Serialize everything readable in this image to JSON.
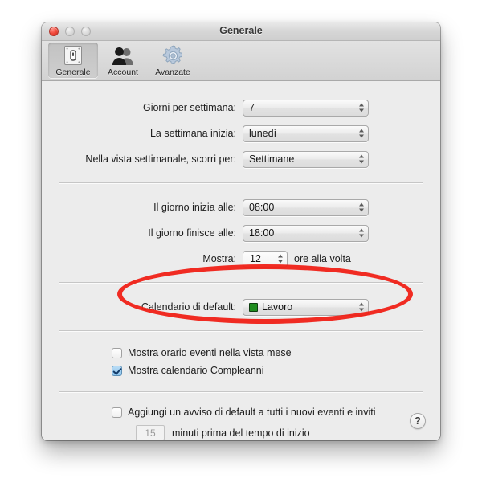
{
  "window": {
    "title": "Generale",
    "controls": {
      "close": "close-button",
      "minimize": "minimize-button",
      "zoom": "zoom-button"
    }
  },
  "toolbar": {
    "items": [
      {
        "label": "Generale",
        "icon": "general-icon",
        "selected": true
      },
      {
        "label": "Account",
        "icon": "accounts-icon",
        "selected": false
      },
      {
        "label": "Avanzate",
        "icon": "gear-icon",
        "selected": false
      }
    ]
  },
  "settings": {
    "group1": [
      {
        "label": "Giorni per settimana:",
        "value": "7"
      },
      {
        "label": "La settimana inizia:",
        "value": "lunedì"
      },
      {
        "label": "Nella vista settimanale, scorri per:",
        "value": "Settimane"
      }
    ],
    "group2": [
      {
        "label": "Il giorno inizia alle:",
        "value": "08:00"
      },
      {
        "label": "Il giorno finisce alle:",
        "value": "18:00"
      }
    ],
    "show_hours": {
      "label": "Mostra:",
      "value": "12",
      "suffix": "ore alla volta"
    },
    "default_calendar": {
      "label": "Calendario di default:",
      "value": "Lavoro",
      "swatch_color": "#1e8c1e"
    },
    "checkboxes": [
      {
        "label": "Mostra orario eventi nella vista mese",
        "checked": false
      },
      {
        "label": "Mostra calendario Compleanni",
        "checked": true
      }
    ],
    "alert": {
      "label": "Aggiungi un avviso di default a tutti i nuovi eventi e inviti",
      "checked": false,
      "minutes": "15",
      "suffix": "minuti prima del tempo di inizio"
    }
  },
  "help": {
    "glyph": "?"
  },
  "annotation": {
    "shape": "ellipse",
    "color": "#f01c12",
    "target": "Calendario di default:"
  }
}
